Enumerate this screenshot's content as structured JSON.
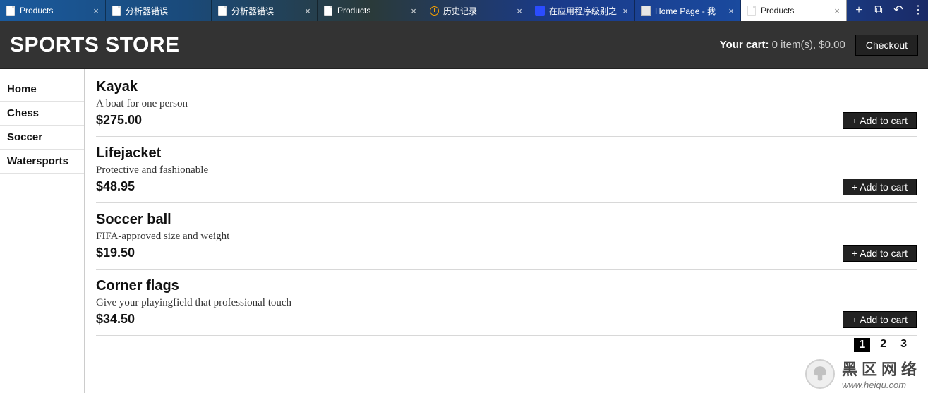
{
  "tabs": [
    {
      "label": "Products",
      "icon": "page",
      "close": true
    },
    {
      "label": "分析器错误",
      "icon": "page",
      "close": false
    },
    {
      "label": "分析器错误",
      "icon": "page",
      "close": true
    },
    {
      "label": "Products",
      "icon": "page",
      "close": true
    },
    {
      "label": "历史记录",
      "icon": "clock",
      "close": true
    },
    {
      "label": "在应用程序级别之",
      "icon": "app",
      "close": true
    },
    {
      "label": "Home Page - 我",
      "icon": "home",
      "close": true
    },
    {
      "label": "Products",
      "icon": "page",
      "close": true
    }
  ],
  "active_tab_index": 7,
  "header": {
    "brand": "SPORTS STORE",
    "cart_label": "Your cart:",
    "cart_summary": "0 item(s), $0.00",
    "checkout": "Checkout"
  },
  "sidebar": {
    "items": [
      {
        "label": "Home"
      },
      {
        "label": "Chess"
      },
      {
        "label": "Soccer"
      },
      {
        "label": "Watersports"
      }
    ]
  },
  "products": [
    {
      "name": "Kayak",
      "desc": "A boat for one person",
      "price": "$275.00",
      "add": "+ Add to cart"
    },
    {
      "name": "Lifejacket",
      "desc": "Protective and fashionable",
      "price": "$48.95",
      "add": "+ Add to cart"
    },
    {
      "name": "Soccer ball",
      "desc": "FIFA-approved size and weight",
      "price": "$19.50",
      "add": "+ Add to cart"
    },
    {
      "name": "Corner flags",
      "desc": "Give your playingfield that professional touch",
      "price": "$34.50",
      "add": "+ Add to cart"
    }
  ],
  "pager": {
    "pages": [
      "1",
      "2",
      "3"
    ],
    "current": 0
  },
  "watermark": {
    "cn": "黑区网络",
    "url": "www.heiqu.com"
  }
}
